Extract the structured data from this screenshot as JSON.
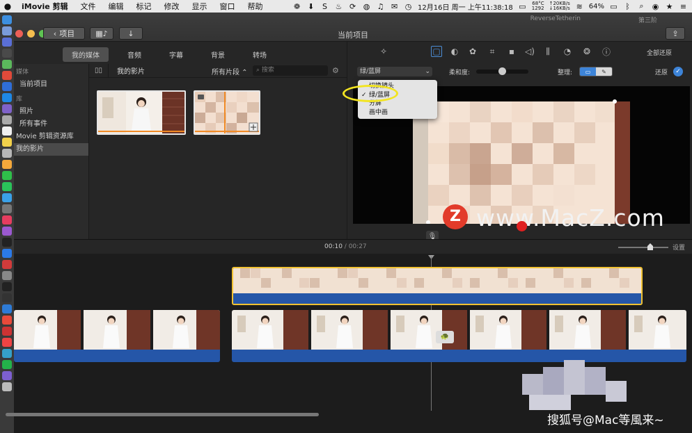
{
  "menubar": {
    "app_name": "iMovie 剪辑",
    "menus": [
      "文件",
      "编辑",
      "标记",
      "修改",
      "显示",
      "窗口",
      "帮助"
    ],
    "datetime": "12月16日 周一 上午11:38:18",
    "temp": "68°C",
    "fan": "1292",
    "net_up": "↑20KB/s",
    "net_down": "↓16KB/s",
    "battery": "64%"
  },
  "window": {
    "title": "当前项目",
    "back_label": "项目",
    "bg_tab": "ReverseTetherin",
    "bg_tab2": "第三阶"
  },
  "media_tabs": [
    "我的媒体",
    "音频",
    "字幕",
    "背景",
    "转场"
  ],
  "sidebar": {
    "items": [
      {
        "label": "媒体",
        "type": "section"
      },
      {
        "label": "当前项目",
        "type": "item"
      },
      {
        "label": "库",
        "type": "section"
      },
      {
        "label": "照片",
        "type": "item"
      },
      {
        "label": "所有事件",
        "type": "item"
      },
      {
        "label": "Movie 剪辑资源库",
        "type": "item"
      },
      {
        "label": "我的影片",
        "type": "selected"
      }
    ]
  },
  "browser": {
    "title": "我的影片",
    "filter": "所有片段 ⌃",
    "search_placeholder": "搜索"
  },
  "viewer": {
    "reset_all": "全部还原",
    "overlay_select": "绿/蓝屏",
    "softness_label": "柔和度:",
    "softness_value": 0.5,
    "cleanup_label": "整理:",
    "restore_label": "还原"
  },
  "dropdown": {
    "items": [
      {
        "label": "切换镜头",
        "checked": false
      },
      {
        "label": "绿/蓝屏",
        "checked": true
      },
      {
        "label": "分屏",
        "checked": false
      },
      {
        "label": "画中画",
        "checked": false
      }
    ]
  },
  "timeline": {
    "current": "00:10",
    "separator": " / ",
    "total": "00:27",
    "settings": "设置"
  },
  "watermark": {
    "badge": "Z",
    "site": "www.MacZ.com",
    "sohu": "搜狐号@Mac等風来~"
  }
}
